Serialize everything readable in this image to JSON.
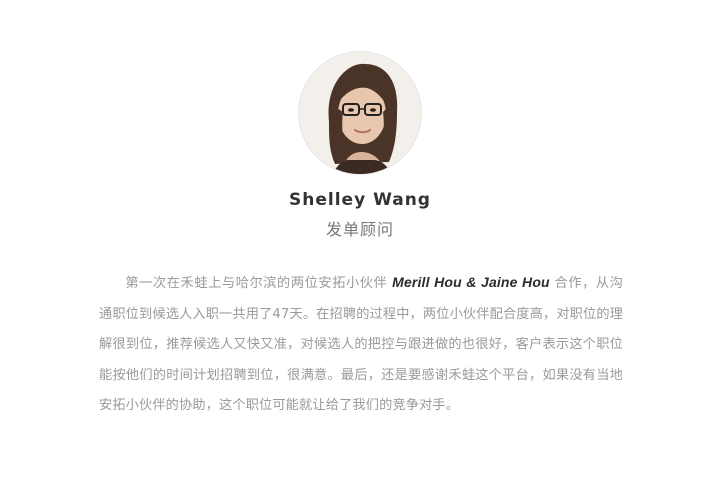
{
  "profile": {
    "name": "Shelley Wang",
    "role": "发单顾问"
  },
  "testimonial": {
    "before": "第一次在禾蛙上与哈尔滨的两位安拓小伙伴 ",
    "partners": "Merill Hou & Jaine Hou",
    "after": " 合作，从沟通职位到候选人入职一共用了47天。在招聘的过程中，两位小伙伴配合度高，对职位的理解很到位，推荐候选人又快又准，对候选人的把控与跟进做的也很好，客户表示这个职位能按他们的时间计划招聘到位，很满意。最后，还是要感谢禾蛙这个平台，如果没有当地安拓小伙伴的协助，这个职位可能就让给了我们的竞争对手。"
  },
  "colors": {
    "name": "#333333",
    "role": "#777777",
    "body_text": "#9a9a9a",
    "highlight": "#2b2b2b",
    "background": "#ffffff"
  }
}
